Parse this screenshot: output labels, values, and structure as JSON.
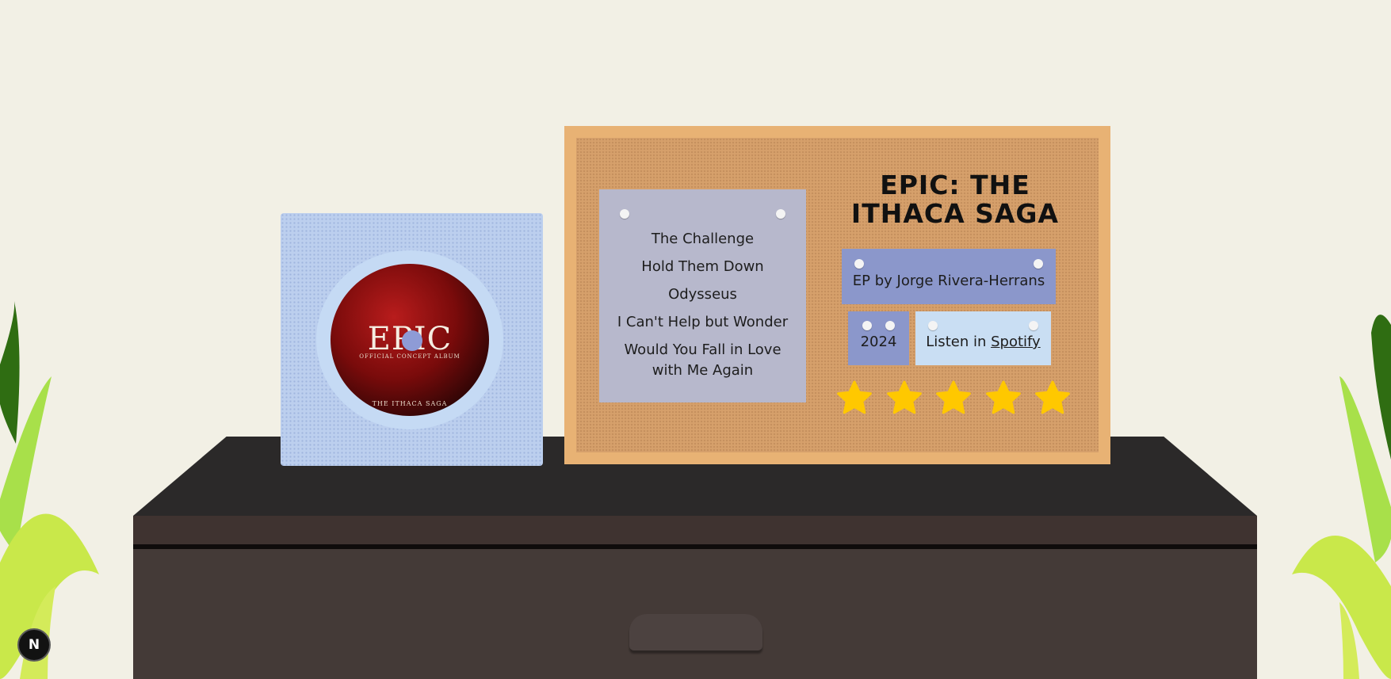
{
  "album": {
    "cover_title": "EPIC",
    "cover_subtitle": "OFFICIAL CONCEPT ALBUM",
    "cover_bottom_text": "THE ITHACA SAGA"
  },
  "board": {
    "title": "EPIC: The Ithaca Saga",
    "tracks": [
      "The Challenge",
      "Hold Them Down",
      "Odysseus",
      "I Can't Help but Wonder",
      "Would You Fall in Love with Me Again"
    ],
    "ep_label": "EP by Jorge Rivera-Herrans",
    "year": "2024",
    "listen_prefix": "Listen in",
    "listen_link": "Spotify",
    "rating": 5,
    "rating_max": 5
  },
  "badge": {
    "label": "N"
  },
  "colors": {
    "background": "#f2f0e5",
    "star": "#ffc800",
    "cork": "#d6a06b",
    "frame": "#e8b274",
    "note_purple": "#8b97cb",
    "note_lilac": "#b7b8cc",
    "note_blue": "#c9def3"
  }
}
